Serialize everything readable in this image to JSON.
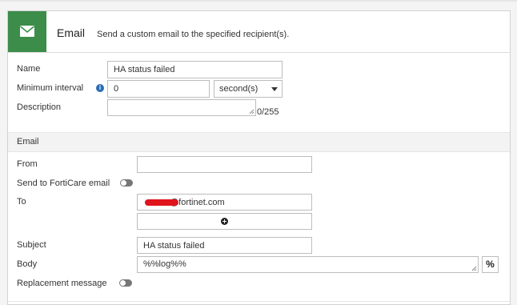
{
  "header": {
    "title": "Email",
    "description": "Send a custom email to the specified recipient(s).",
    "icon": "envelope-icon",
    "icon_bg": "#3c8d4a"
  },
  "general": {
    "name_label": "Name",
    "name_value": "HA status failed",
    "min_interval_label": "Minimum interval",
    "min_interval_value": "0",
    "interval_unit": "second(s)",
    "description_label": "Description",
    "description_value": "",
    "char_count": "0/255"
  },
  "email_section": {
    "title": "Email",
    "from_label": "From",
    "from_value": "",
    "forticare_label": "Send to FortiCare email",
    "to_label": "To",
    "to_value": "@fortinet.com",
    "subject_label": "Subject",
    "subject_value": "HA status failed",
    "body_label": "Body",
    "body_value": "%%log%%",
    "body_macro_button": "%",
    "replacement_label": "Replacement message"
  }
}
